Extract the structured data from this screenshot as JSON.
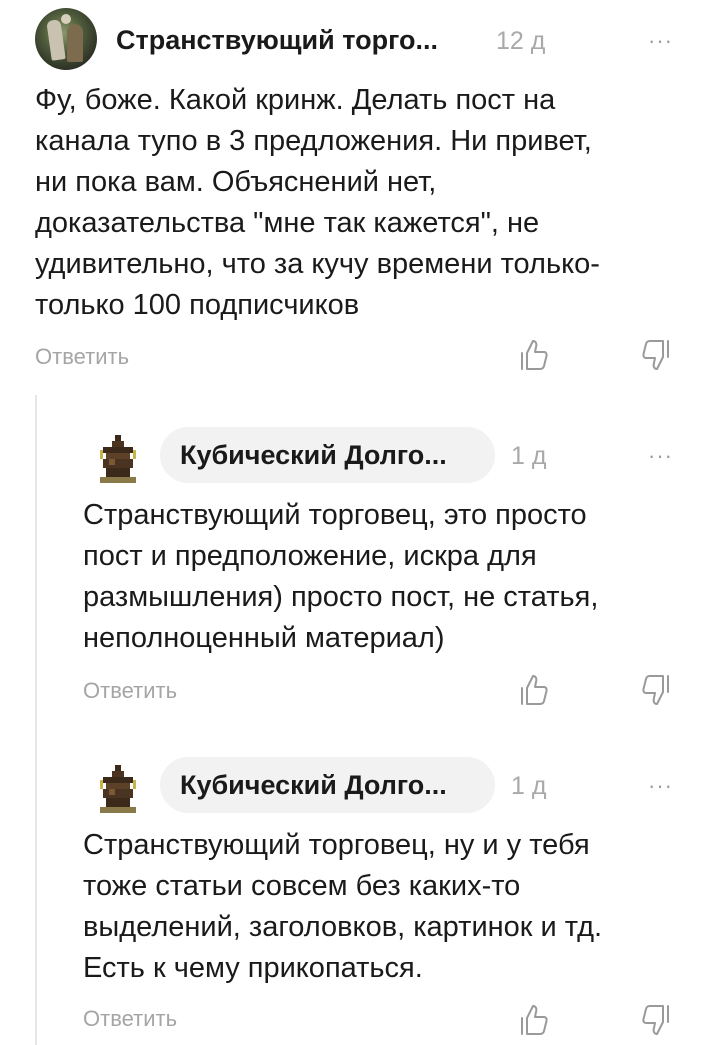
{
  "comments": [
    {
      "author": "Странствующий торго...",
      "time": "12 д",
      "lines": [
        "Фу, боже. Какой кринж. Делать пост на",
        "канала тупо в 3 предложения. Ни привет,",
        "ни пока вам. Объяснений нет,",
        "доказательства \"мне так кажется\", не",
        "удивительно, что за кучу времени только-",
        "только 100 подписчиков"
      ],
      "reply_label": "Ответить",
      "more_label": "···"
    },
    {
      "author": "Кубический Долго...",
      "time": "1 д",
      "lines": [
        "Странствующий торговец, это просто",
        "пост и предположение, искра для",
        "размышления) просто пост, не статья,",
        "неполноценный материал)"
      ],
      "reply_label": "Ответить",
      "more_label": "···"
    },
    {
      "author": "Кубический Долго...",
      "time": "1 д",
      "lines": [
        "Странствующий торговец, ну и у тебя",
        "тоже статьи совсем без каких-то",
        "выделений, заголовков, картинок и тд.",
        "Есть к чему прикопаться."
      ],
      "reply_label": "Ответить",
      "more_label": "···"
    }
  ],
  "icons": {
    "like": "thumbs-up-outline-icon",
    "dislike": "thumbs-down-outline-icon",
    "more": "more-dots-icon"
  },
  "colors": {
    "text": "#1a1a1a",
    "muted": "#a5a5a5",
    "pill": "#f2f2f2",
    "thread_line": "#e6e6e6"
  }
}
